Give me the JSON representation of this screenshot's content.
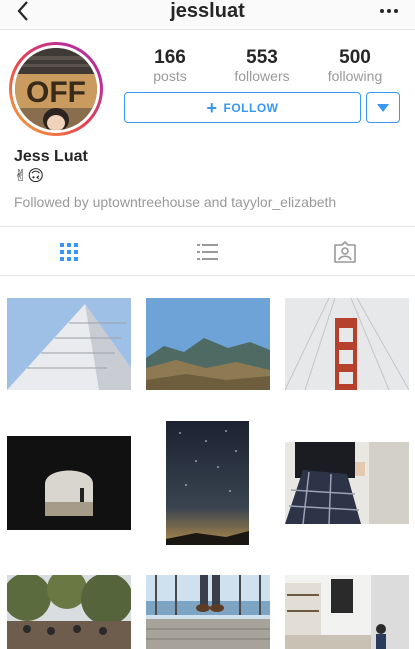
{
  "header": {
    "username": "jessluat",
    "back_icon": "chevron-left-icon",
    "more_icon": "ellipsis-icon"
  },
  "profile": {
    "full_name": "Jess Luat",
    "bio": "✌🙃",
    "followed_by": "Followed by uptowntreehouse and tayylor_elizabeth",
    "avatar_ring_colors": [
      "#f4b23a",
      "#e8414f",
      "#b92f99"
    ],
    "avatar_sign_text": "OFF"
  },
  "stats": {
    "posts": {
      "value": "166",
      "label": "posts"
    },
    "followers": {
      "value": "553",
      "label": "followers"
    },
    "following": {
      "value": "500",
      "label": "following"
    }
  },
  "actions": {
    "follow_label": "FOLLOW",
    "accent_color": "#3897f0"
  },
  "tabs": [
    {
      "name": "grid-view",
      "icon": "grid-icon",
      "active": true
    },
    {
      "name": "list-view",
      "icon": "list-icon",
      "active": false
    },
    {
      "name": "tagged",
      "icon": "tagged-person-icon",
      "active": false
    }
  ],
  "posts": [
    {
      "subject": "building-looking-up"
    },
    {
      "subject": "mountain-landscape"
    },
    {
      "subject": "golden-gate-bridge-fog"
    },
    {
      "subject": "tunnel-silhouette"
    },
    {
      "subject": "milky-way-night-sky"
    },
    {
      "subject": "person-plaid-shirt"
    },
    {
      "subject": "outdoor-market-trees"
    },
    {
      "subject": "feet-on-pier"
    },
    {
      "subject": "cafe-interior"
    }
  ]
}
